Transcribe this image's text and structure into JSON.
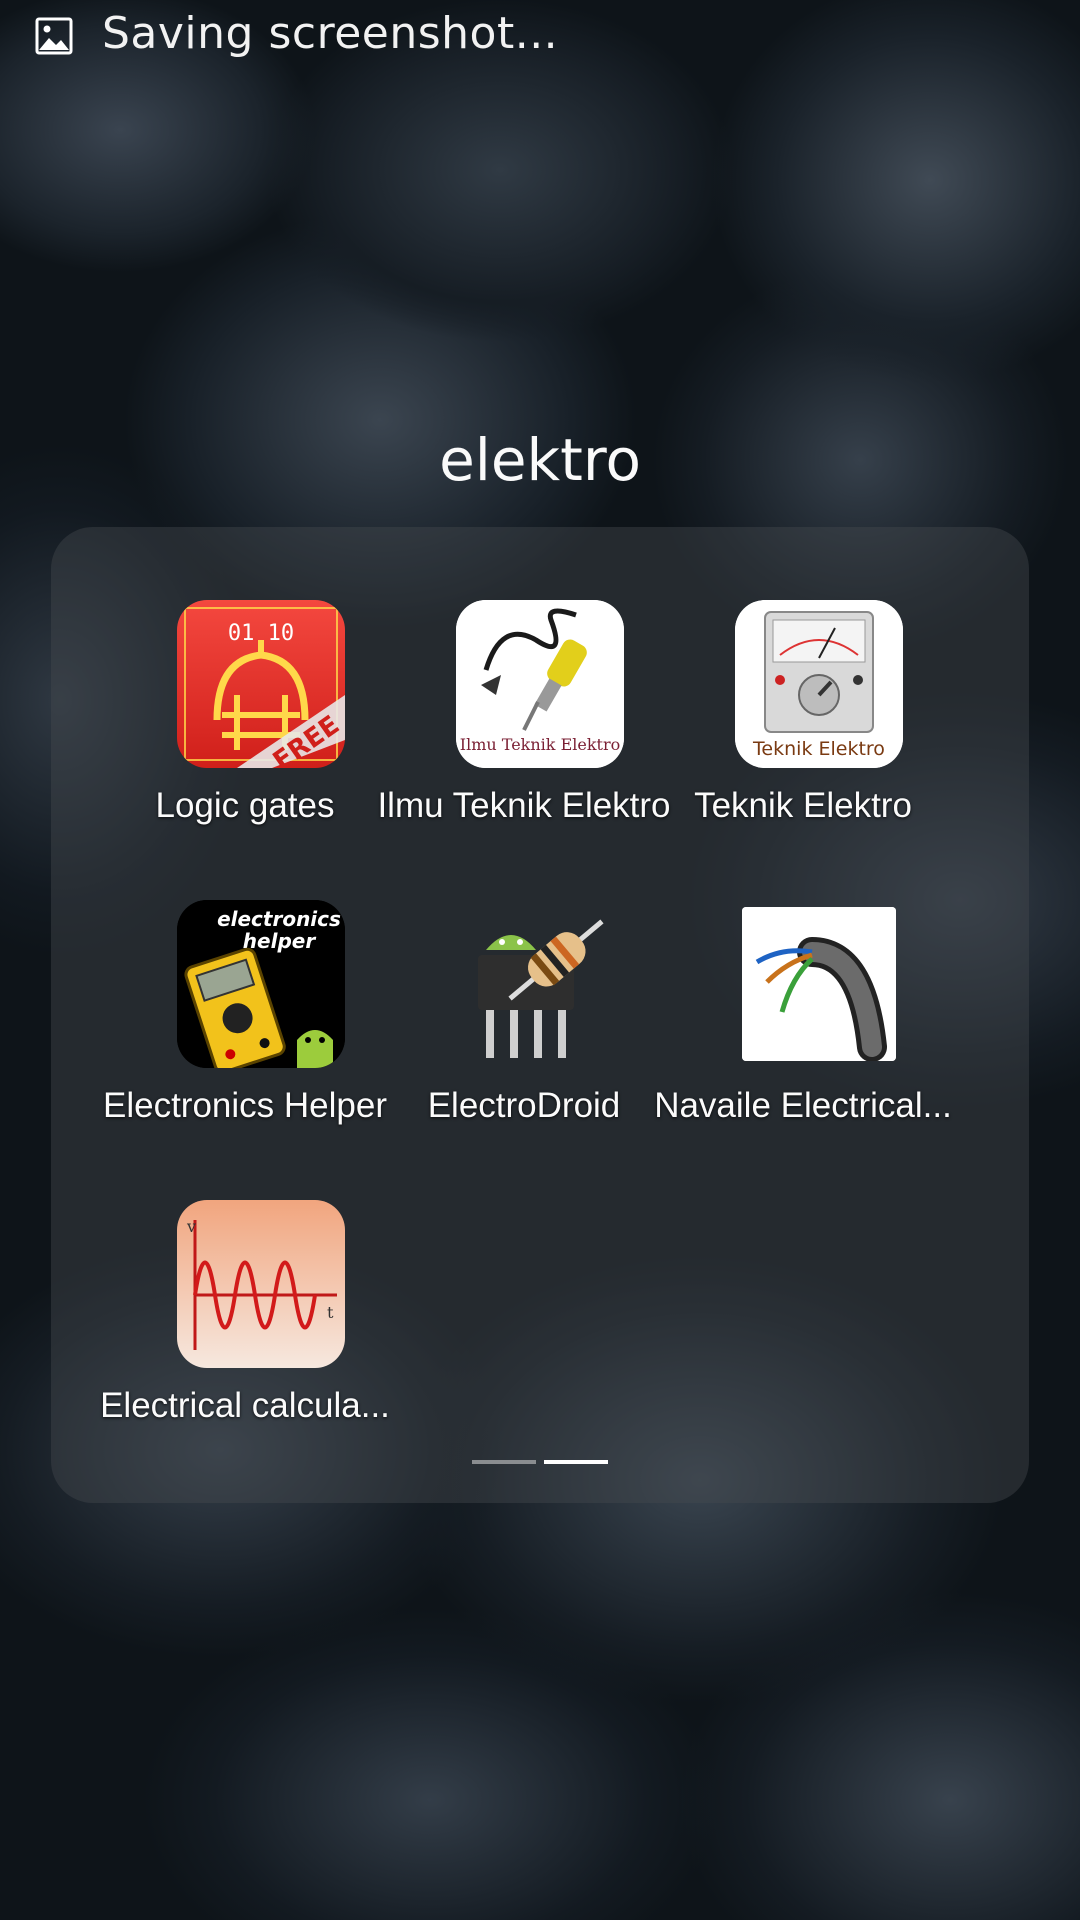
{
  "status_bar": {
    "icon": "image-icon",
    "text": "Saving screenshot..."
  },
  "folder": {
    "title": "elektro",
    "apps": [
      {
        "label": "Logic gates",
        "icon": "logic-gates-app-icon",
        "icon_text_top": "01 10",
        "icon_text_badge": "FREE"
      },
      {
        "label": "Ilmu Teknik Elektro",
        "icon": "soldering-iron-app-icon",
        "icon_caption": "Ilmu Teknik Elektro"
      },
      {
        "label": "Teknik Elektro",
        "icon": "multimeter-app-icon",
        "icon_caption": "Teknik Elektro"
      },
      {
        "label": "Electronics Helper",
        "icon": "electronics-helper-app-icon",
        "icon_caption_1": "electronics",
        "icon_caption_2": "helper"
      },
      {
        "label": "ElectroDroid",
        "icon": "electrodroid-app-icon"
      },
      {
        "label": "Navaile Electrical...",
        "icon": "cable-app-icon"
      },
      {
        "label": "Electrical calcula...",
        "icon": "sine-wave-app-icon",
        "icon_axis_v": "v",
        "icon_axis_t": "t"
      }
    ],
    "page_indicator": {
      "pages": 2,
      "current": 2
    }
  },
  "colors": {
    "panel": "#464a4e",
    "indicator_active": "#ffffff",
    "indicator_inactive": "#8a8d90"
  }
}
